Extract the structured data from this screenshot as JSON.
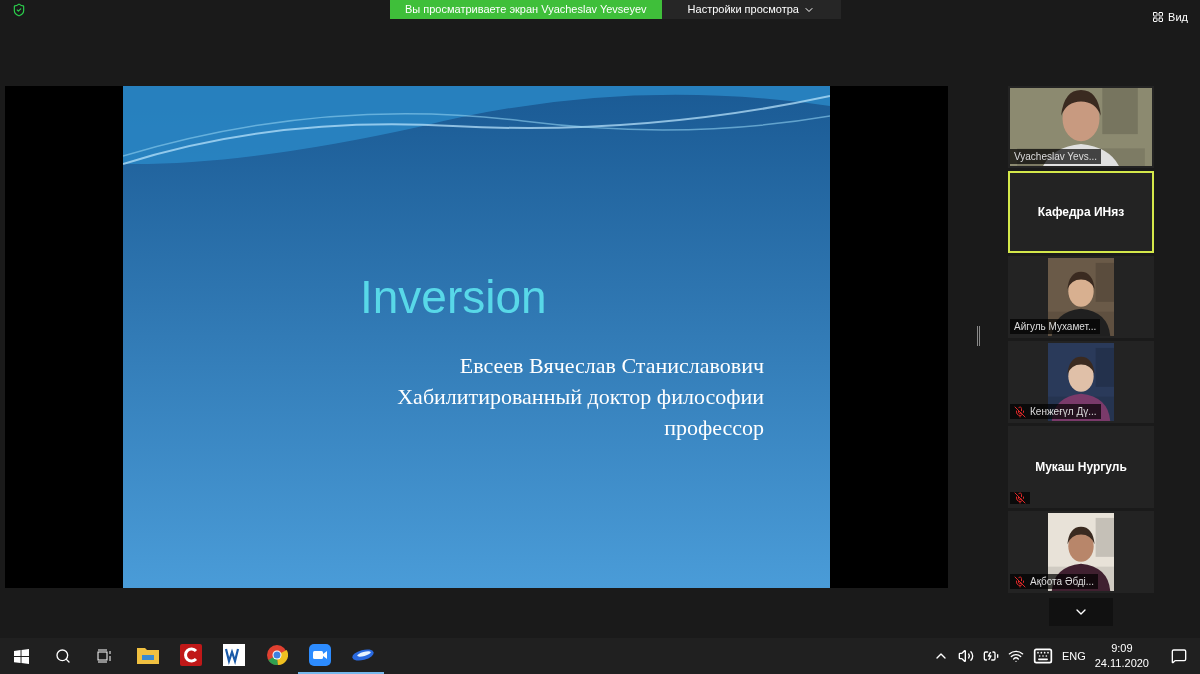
{
  "top_bar": {
    "sharing_notice": "Вы просматриваете экран Vyacheslav Yevseyev",
    "view_options": "Настройки просмотра",
    "view_button": "Вид"
  },
  "slide": {
    "title": "Inversion",
    "lines": [
      "Евсеев Вячеслав Станиславович",
      "Хабилитированный доктор философии",
      "профессор"
    ]
  },
  "participants": [
    {
      "kind": "video",
      "name": "Vyacheslav Yevs...",
      "muted": false,
      "speaking": false
    },
    {
      "kind": "name",
      "name": "Кафедра ИНяз",
      "muted": false,
      "speaking": true
    },
    {
      "kind": "video",
      "name": "Айгуль Мухамет...",
      "muted": false,
      "speaking": false
    },
    {
      "kind": "video",
      "name": "Кенжеғүл Дү...",
      "muted": true,
      "speaking": false
    },
    {
      "kind": "name",
      "name": "Мукаш Нургуль",
      "muted": true,
      "speaking": false
    },
    {
      "kind": "video",
      "name": "Ақбота Әбді...",
      "muted": true,
      "speaking": false
    }
  ],
  "taskbar": {
    "apps": [
      {
        "kind": "explorer",
        "running": false
      },
      {
        "kind": "reader",
        "running": false
      },
      {
        "kind": "word",
        "running": false
      },
      {
        "kind": "chrome",
        "running": false
      },
      {
        "kind": "zoom",
        "running": true
      },
      {
        "kind": "app",
        "running": true
      }
    ],
    "language": "ENG",
    "time": "9:09",
    "date": "24.11.2020"
  }
}
